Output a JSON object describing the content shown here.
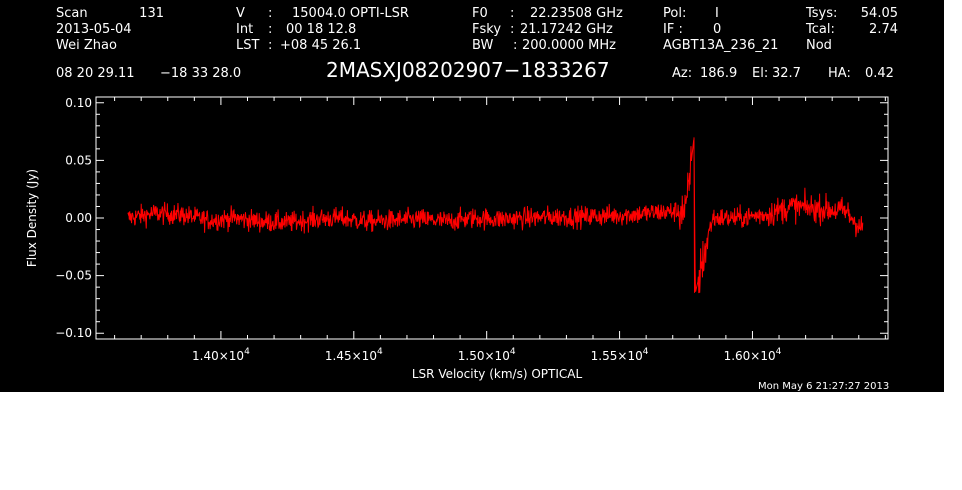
{
  "header": {
    "scan_label": "Scan",
    "scan_number": "131",
    "date": "2013-05-04",
    "observer": "Wei Zhao",
    "v_label": "V",
    "v_sep": ":",
    "v_value": "15004.0 OPTI-LSR",
    "int_label": "Int",
    "int_sep": ":",
    "int_value": "00 18 12.8",
    "lst_label": "LST",
    "lst_sep": ":",
    "lst_value": "+08 45 26.1",
    "f0_label": "F0",
    "f0_sep": ":",
    "f0_value": "22.23508 GHz",
    "fsky_label": "Fsky",
    "fsky_sep": ":",
    "fsky_value": "21.17242 GHz",
    "bw_label": "BW",
    "bw_sep": ":",
    "bw_value": "200.0000 MHz",
    "pol_label": "Pol:",
    "pol_value": "I",
    "if_label": "IF :",
    "if_value": "0",
    "project": "AGBT13A_236_21",
    "tsys_label": "Tsys:",
    "tsys_value": "54.05",
    "tcal_label": "Tcal:",
    "tcal_value": "2.74",
    "mode": "Nod",
    "ra": "08 20 29.11",
    "dec": "−18 33 28.0",
    "source": "2MASXJ08202907−1833267",
    "az_label": "Az:",
    "az_value": "186.9",
    "el_label": "El:",
    "el_value": "32.7",
    "ha_label": "HA:",
    "ha_value": "0.42"
  },
  "footer": {
    "timestamp": "Mon May  6 21:27:27 2013"
  },
  "chart_data": {
    "type": "line",
    "title": "",
    "xlabel": "LSR Velocity (km/s) OPTICAL",
    "ylabel": "Flux Density (Jy)",
    "xlim": [
      13530,
      16510
    ],
    "ylim": [
      -0.105,
      0.105
    ],
    "x_ticks": [
      {
        "value": 14000,
        "mantissa": "1.40",
        "exponent": "4"
      },
      {
        "value": 14500,
        "mantissa": "1.45",
        "exponent": "4"
      },
      {
        "value": 15000,
        "mantissa": "1.50",
        "exponent": "4"
      },
      {
        "value": 15500,
        "mantissa": "1.55",
        "exponent": "4"
      },
      {
        "value": 16000,
        "mantissa": "1.60",
        "exponent": "4"
      }
    ],
    "y_ticks": [
      {
        "value": 0.1,
        "label": "0.10"
      },
      {
        "value": 0.05,
        "label": "0.05"
      },
      {
        "value": 0.0,
        "label": "0.00"
      },
      {
        "value": -0.05,
        "label": "−0.05"
      },
      {
        "value": -0.1,
        "label": "−0.10"
      }
    ],
    "series": [
      {
        "color": "#ff0000",
        "x_start": 13650,
        "x_end": 16415,
        "points": [
          [
            13650,
            0.0
          ],
          [
            13750,
            0.004
          ],
          [
            13850,
            0.003
          ],
          [
            13950,
            -0.002
          ],
          [
            14050,
            0.0
          ],
          [
            14150,
            -0.003
          ],
          [
            14250,
            -0.004
          ],
          [
            14350,
            -0.001
          ],
          [
            14450,
            0.0
          ],
          [
            14550,
            -0.003
          ],
          [
            14650,
            -0.002
          ],
          [
            14750,
            -0.001
          ],
          [
            14850,
            -0.003
          ],
          [
            14950,
            0.0
          ],
          [
            15050,
            -0.001
          ],
          [
            15150,
            0.0
          ],
          [
            15250,
            0.001
          ],
          [
            15350,
            0.001
          ],
          [
            15450,
            0.002
          ],
          [
            15550,
            0.003
          ],
          [
            15650,
            0.005
          ],
          [
            15750,
            0.006
          ],
          [
            15780,
            0.07
          ],
          [
            15785,
            -0.065
          ],
          [
            15850,
            0.0
          ],
          [
            15950,
            0.0
          ],
          [
            16050,
            0.003
          ],
          [
            16150,
            0.01
          ],
          [
            16250,
            0.008
          ],
          [
            16350,
            0.006
          ],
          [
            16415,
            -0.01
          ]
        ]
      }
    ]
  }
}
